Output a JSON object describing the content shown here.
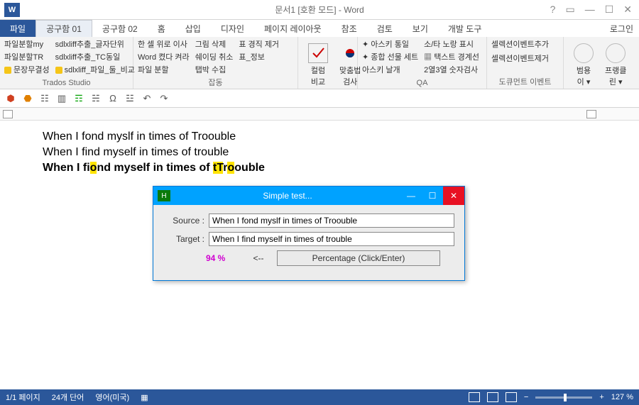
{
  "title": "문서1 [호환 모드] - Word",
  "login": "로그인",
  "menu": {
    "file": "파일",
    "tool1": "공구함 01",
    "tool2": "공구함 02",
    "home": "홈",
    "insert": "삽입",
    "design": "디자인",
    "layout": "페이지 레이아웃",
    "refs": "참조",
    "review": "검토",
    "view": "보기",
    "dev": "개발 도구"
  },
  "ribbon": {
    "g1": {
      "label": "Trados Studio",
      "i1": "파일분할my",
      "i2": "파일분할TR",
      "i3": "문장무결성",
      "i4": "sdlxliff추출_글자단위",
      "i5": "sdlxliff추출_TC동일",
      "i6": "sdlxliff_파일_둘_비교"
    },
    "g2": {
      "label": "잡동",
      "i1": "한 셀 위로 이사",
      "i2": "Word 켰다 켜라",
      "i3": "파일 분할",
      "i4": "그림 삭제",
      "i5": "쉐이딩 취소",
      "i6": "탭박 수집",
      "i7": "표 경직 제거",
      "i8": "표_정보"
    },
    "g3": {
      "b1": "컬럼\n비교",
      "b2": "맞춤법\n검사"
    },
    "g4": {
      "label": "QA",
      "i1": "아스키 통일",
      "i2": "종합 선물 세트",
      "i3": "아스키 날개",
      "i4": "소/타 노랑 표시",
      "i5": "택스트 경계선",
      "i6": "2열3열 숫자검사"
    },
    "g5": {
      "label": "도큐먼트 이벤트",
      "i1": "셀렉션이벤트추가",
      "i2": "셀렉션이벤트제거"
    },
    "g6": {
      "b1": "범용\n이 ▾",
      "b2": "프랭클\n린 ▾"
    }
  },
  "doc": {
    "line1": "When  I fond myslf  in times  of Troouble",
    "line2": "When  I find myself  in times  of trouble",
    "l3a": "When I fi",
    "l3b": "o",
    "l3c": "nd mys",
    "l3d": "e",
    "l3e": "lf in times of ",
    "l3f": "tT",
    "l3g": "r",
    "l3h": "o",
    "l3i": "ouble"
  },
  "dialog": {
    "title": "Simple test...",
    "srcLabel": "Source  :",
    "tgtLabel": "Target   :",
    "src": "When I fond myslf in times of Troouble",
    "tgt": "When I find myself in times of trouble",
    "pct": "94 %",
    "arrow": "<--",
    "btn": "Percentage  (Click/Enter)"
  },
  "status": {
    "page": "1/1 페이지",
    "words": "24개 단어",
    "lang": "영어(미국)",
    "zoom": "127 %"
  }
}
